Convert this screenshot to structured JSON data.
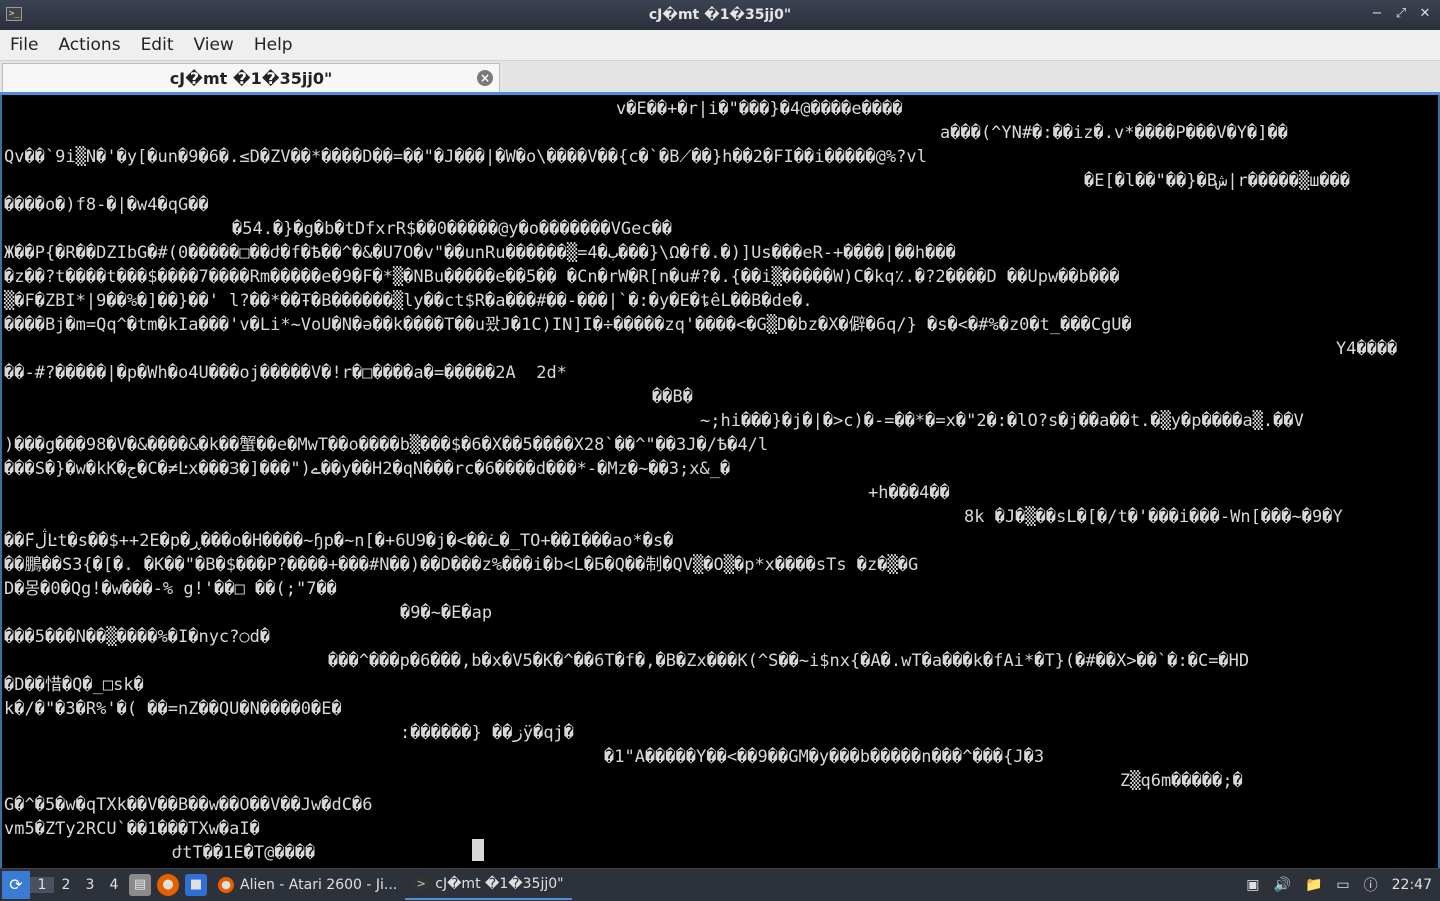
{
  "window": {
    "title": "cJ�mt �1�35jj0\"",
    "controls": [
      "−",
      "⤢",
      "✕"
    ]
  },
  "menubar": {
    "items": [
      "File",
      "Actions",
      "Edit",
      "View",
      "Help"
    ]
  },
  "tab": {
    "label": "cJ�mt �1�35jj0\"",
    "close": "×"
  },
  "terminal": {
    "lines": [
      {
        "indent": 612,
        "text": "v�E��+�r|i�\"���}�4@����e����"
      },
      {
        "indent": 936,
        "text": "a���(^YN#�:��iz�.v*����P���V�Y�]��"
      },
      {
        "indent": 0,
        "text": "Qv��`9i▒N�'�y[�un�9�6�.≤D�ZV��*����D��=��\"�J���|�W�o\\����V��{c�`�B⟋��}h��2�FI��i�����@%?vl"
      },
      {
        "indent": 1080,
        "text": "�E[�l��\"��}�Bش|r�����▒ш���"
      },
      {
        "indent": 0,
        "text": "����o�)f8-�|�w4�qG��"
      },
      {
        "indent": 228,
        "text": "�54.�}�g�b�tDfxrR$��0�����@y�o�������VGec��"
      },
      {
        "indent": 0,
        "text": "Ж��P{�R��DZIbG�#(0�����□��ժ�f�Ѣ��^�&�U7O�v\"��unRu������▒=4�ب���}\\Ω�f�.�)]Us���eR-+����|��h���"
      },
      {
        "indent": 0,
        "text": "�z��?t����t���$����7����Rm�����e�9�F�*▒�NBu�����e��5�� �Cn�rW�R[n�u#?�.{��i▒�����W)C�kq٪.�?2����D ��Upw��b���"
      },
      {
        "indent": 0,
        "text": "▒�F�ZBI*|9��%�]��}��' l?��*��Ŧ�B������▒ly��ct$R�a���#��-���|`�:�y�E�ȶêL��B�de�."
      },
      {
        "indent": 0,
        "text": "����Bj�m=Qq^�tm�kIa���'v�Li*~VoU�N�ə��k����T��u꽜J�1C)IN]I�÷�����zq'����<�G▒D�bz�X�僻�6q/} �s�<�#%�z0�t_���CgU�"
      },
      {
        "indent": 1332,
        "text": "Y4����"
      },
      {
        "indent": 0,
        "text": "��-#?�����|�p�Wh�o4U���oj�����V�!r�□����a�=�����2A  2d*"
      },
      {
        "indent": 648,
        "text": "��B�"
      },
      {
        "indent": 696,
        "text": "~;hi���}�j�|�>c)�-=��*�=x�\"2�:�lO?s�j��a��t.�▒y�p����a▒.��V"
      },
      {
        "indent": 0,
        "text": ")���g���98�V�&����&�k��蟹��e�MwT��o����b▒���$�6�X��5����X28`��^\"��3J�/Ѣ�4/l"
      },
      {
        "indent": 0,
        "text": "���S�}�w�kK�ج�C�≠Ŀx���Ɜ�]���\")ے��y��H2�qN���rc�6����d���*-�Mz�~��3;x&_�"
      },
      {
        "indent": 864,
        "text": "+h���4��"
      },
      {
        "indent": 960,
        "text": "8k �J�▒��sL�[�/t�'���i���-Wn[���~�9�Y"
      },
      {
        "indent": 0,
        "text": "��Fڷ̆Ŀt�s��$++2E�p�ڕ���o�H����~ɧp�~n[�+6U9�j�<��ᢽ�_TO+��I���ao*�s�"
      },
      {
        "indent": 0,
        "text": "��鵬��S3{�[�. �K��\"�B�$���P?����+���#N��)��D���z%���i�b<L�Ƃ�Q��制�QV▒�O▒�p*x����sTs �z�▒�G"
      },
      {
        "indent": 0,
        "text": "D�몽�0�Qg!�w���-% g!'��□ ��(;\"7��"
      },
      {
        "indent": 396,
        "text": "�9�~�E�ap"
      },
      {
        "indent": 0,
        "text": "���5���N��▒����%�I�nyc?○d�"
      },
      {
        "indent": 324,
        "text": "���^���p�6���,b�x�V5�K�^��6T�f�,�B�Zx���K(^S��~i$nx{�A�.wT�a���k�fAi*�T}(�#��X>��`�:�C=�HD"
      },
      {
        "indent": 0,
        "text": "�D��惜�Q�_□sk�"
      },
      {
        "indent": 0,
        "text": "k�/�\"�3�R%'�( ��=nZ��QU�N����0�E�"
      },
      {
        "indent": 396,
        "text": ":������} ��زÿ�qj�"
      },
      {
        "indent": 600,
        "text": "�1\"A�����Y��<��9��GM�y���b�����n���^���{J�3"
      },
      {
        "indent": 1116,
        "text": "Z▒q6m�����;�"
      },
      {
        "indent": 0,
        "text": "G�^�5�w�qTXk��V��B��w��O��V��Jw�dC�6"
      },
      {
        "indent": 0,
        "text": "vm5�ZƬy2RCU`��1���TXw�aI�"
      },
      {
        "indent": 168,
        "text": "ժtT��1E�T@����"
      }
    ]
  },
  "taskbar": {
    "start_icon": "start-menu-icon",
    "workspaces": [
      "1",
      "2",
      "3",
      "4"
    ],
    "tasks": [
      {
        "label": "Alien - Atari 2600 - Ji...",
        "icon": "firefox-icon"
      },
      {
        "label": "cJ�mt �1�35jj0\"",
        "icon": "terminal-icon"
      }
    ],
    "clock": "22:47"
  }
}
